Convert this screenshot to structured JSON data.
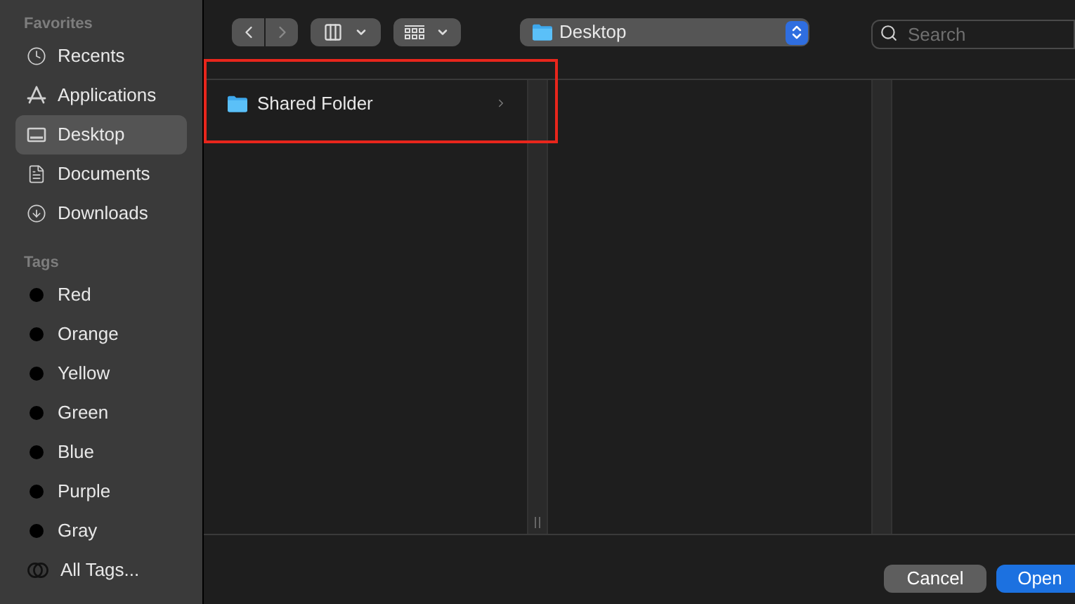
{
  "sidebar": {
    "sections": [
      {
        "title": "Favorites",
        "items": [
          {
            "label": "Recents",
            "kind": "recents",
            "selected": false
          },
          {
            "label": "Applications",
            "kind": "applications",
            "selected": false
          },
          {
            "label": "Desktop",
            "kind": "desktop",
            "selected": true
          },
          {
            "label": "Documents",
            "kind": "documents",
            "selected": false
          },
          {
            "label": "Downloads",
            "kind": "downloads",
            "selected": false
          }
        ]
      },
      {
        "title": "Tags",
        "items": [
          {
            "label": "Red",
            "kind": "tag",
            "selected": false
          },
          {
            "label": "Orange",
            "kind": "tag",
            "selected": false
          },
          {
            "label": "Yellow",
            "kind": "tag",
            "selected": false
          },
          {
            "label": "Green",
            "kind": "tag",
            "selected": false
          },
          {
            "label": "Blue",
            "kind": "tag",
            "selected": false
          },
          {
            "label": "Purple",
            "kind": "tag",
            "selected": false
          },
          {
            "label": "Gray",
            "kind": "tag",
            "selected": false
          },
          {
            "label": "All Tags...",
            "kind": "all-tags",
            "selected": false
          }
        ]
      }
    ]
  },
  "toolbar": {
    "location": "Desktop",
    "search": {
      "placeholder": "Search"
    }
  },
  "columns": [
    {
      "items": [
        {
          "label": "Shared Folder",
          "highlighted": true
        }
      ]
    }
  ],
  "buttons": [
    {
      "label": "Cancel",
      "kind": "secondary"
    },
    {
      "label": "Open",
      "kind": "primary"
    }
  ]
}
